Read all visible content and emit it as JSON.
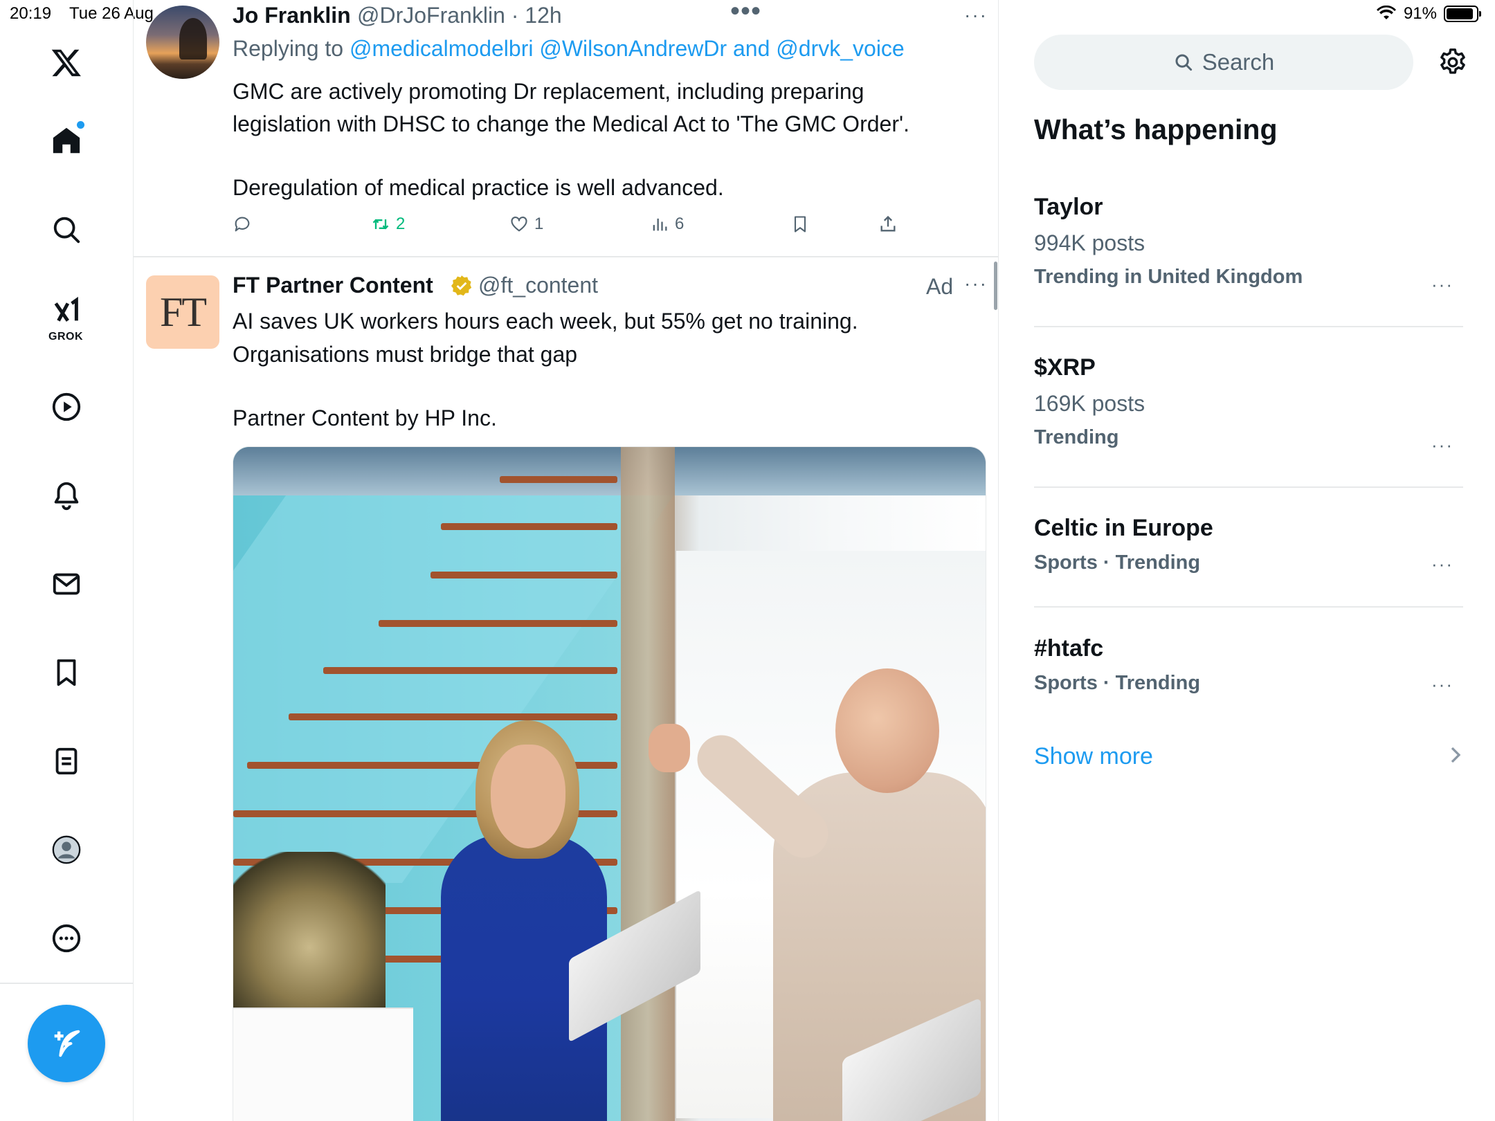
{
  "status": {
    "time": "20:19",
    "date": "Tue 26 Aug",
    "battery": "91%",
    "battery_level": 0.91
  },
  "nav": {
    "items": [
      "home-icon",
      "search-icon",
      "grok-icon",
      "video-icon",
      "notifications-icon",
      "messages-icon",
      "bookmarks-icon",
      "lists-icon",
      "profile-icon",
      "more-icon"
    ],
    "grok_label": "GROK",
    "compose": "compose-icon"
  },
  "tweet1": {
    "name": "Jo Franklin",
    "handle": "@DrJoFranklin · 12h",
    "replying_prefix": "Replying to ",
    "replying_to": "@medicalmodelbri @WilsonAndrewDr and @drvk_voice",
    "text_line1": "GMC are actively promoting Dr replacement, including preparing",
    "text_line2": "legislation with DHSC to change the Medical Act to 'The GMC Order'.",
    "text_line3": "Deregulation of medical practice is well advanced.",
    "retweets": "2",
    "likes": "1",
    "views": "6"
  },
  "tweet2": {
    "logo": "FT",
    "name": "FT Partner Content",
    "handle": "@ft_content",
    "ad_label": "Ad",
    "text_line1": "AI saves UK workers hours each week, but 55% get no training.",
    "text_line2": "Organisations must bridge that gap",
    "text_line3": "Partner Content by HP Inc."
  },
  "right": {
    "search_placeholder": "Search",
    "heading": "What’s happening",
    "trends": [
      {
        "name": "Taylor",
        "posts": "994K posts",
        "meta": "Trending in United Kingdom"
      },
      {
        "name": "$XRP",
        "posts": "169K posts",
        "meta": "Trending"
      },
      {
        "name": "Celtic in Europe",
        "meta": "Sports · Trending"
      },
      {
        "name": "#htafc",
        "meta": "Sports · Trending"
      }
    ],
    "show_more": "Show more"
  },
  "colors": {
    "accent": "#1d9bf0",
    "retweet": "#00ba7c",
    "muted": "#536471",
    "text": "#0f1419"
  }
}
